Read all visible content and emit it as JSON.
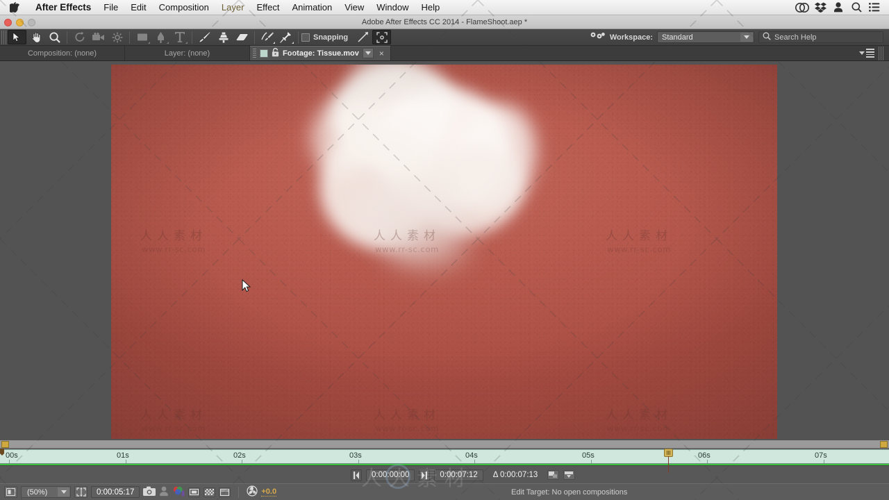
{
  "os_menu": {
    "apple_icon": "apple-logo",
    "items": [
      {
        "label": "After Effects",
        "bold": true,
        "highlight": false
      },
      {
        "label": "File",
        "bold": false,
        "highlight": false
      },
      {
        "label": "Edit",
        "bold": false,
        "highlight": false
      },
      {
        "label": "Composition",
        "bold": false,
        "highlight": false
      },
      {
        "label": "Layer",
        "bold": false,
        "highlight": true
      },
      {
        "label": "Effect",
        "bold": false,
        "highlight": false
      },
      {
        "label": "Animation",
        "bold": false,
        "highlight": false
      },
      {
        "label": "View",
        "bold": false,
        "highlight": false
      },
      {
        "label": "Window",
        "bold": false,
        "highlight": false
      },
      {
        "label": "Help",
        "bold": false,
        "highlight": false
      }
    ],
    "status_icons": [
      "creative-cloud-icon",
      "dropbox-icon",
      "user-icon",
      "spotlight-search-icon",
      "notification-center-icon"
    ]
  },
  "window": {
    "title": "Adobe After Effects CC 2014 - FlameShoot.aep *",
    "controls": [
      "close",
      "minimize",
      "zoom"
    ]
  },
  "toolbar": {
    "tools": [
      {
        "name": "selection-tool",
        "active": true,
        "dim": false
      },
      {
        "name": "hand-tool",
        "active": false,
        "dim": false
      },
      {
        "name": "zoom-tool",
        "active": false,
        "dim": false
      },
      {
        "name": "rotation-tool",
        "active": false,
        "dim": true
      },
      {
        "name": "camera-tool",
        "active": false,
        "dim": true
      },
      {
        "name": "pan-behind-tool",
        "active": false,
        "dim": true
      },
      {
        "name": "shape-tool",
        "active": false,
        "dim": true
      },
      {
        "name": "pen-tool",
        "active": false,
        "dim": true
      },
      {
        "name": "type-tool",
        "active": false,
        "dim": true
      },
      {
        "name": "brush-tool",
        "active": false,
        "dim": false
      },
      {
        "name": "clone-stamp-tool",
        "active": false,
        "dim": false
      },
      {
        "name": "eraser-tool",
        "active": false,
        "dim": false
      },
      {
        "name": "roto-brush-tool",
        "active": false,
        "dim": false
      },
      {
        "name": "puppet-pin-tool",
        "active": false,
        "dim": false
      }
    ],
    "snapping_label": "Snapping",
    "snapping_checked": false,
    "workspace_label": "Workspace:",
    "workspace_value": "Standard",
    "search_placeholder": "Search Help"
  },
  "panel_tabs": {
    "tabs": [
      {
        "label": "Composition: (none)",
        "active": false
      },
      {
        "label": "Layer: (none)",
        "active": false
      },
      {
        "label": "Footage: Tissue.mov",
        "active": true
      }
    ],
    "close_label": "×"
  },
  "viewer": {
    "watermark_cn": "人人素材",
    "watermark_url": "www.rr-sc.com",
    "background_color": "#b8584c",
    "subject": "white tissue"
  },
  "timeline": {
    "ticks": [
      "00s",
      "01s",
      "02s",
      "03s",
      "04s",
      "05s",
      "06s",
      "07s"
    ],
    "playhead_time_label": "0:00:05:17",
    "work_area_color": "#3fbf3f",
    "ruler_color": "#cfe7dd"
  },
  "transport": {
    "in_point": "0:00:00:00",
    "out_point": "0:00:07:12",
    "duration": "Δ 0:00:07:13",
    "in_icon": "in-point-icon",
    "out_icon": "out-point-icon",
    "ripple_icons": [
      "lift-work-area-icon",
      "extract-work-area-icon"
    ]
  },
  "statusbar": {
    "zoom_level": "(50%)",
    "current_time": "0:00:05:17",
    "exposure": "+0.0",
    "edit_target": "Edit Target: No open compositions",
    "icons": [
      "always-preview-this-view-icon",
      "region-of-interest-icon",
      "take-snapshot-icon",
      "show-snapshot-icon",
      "show-channel-icon",
      "resolution-icon",
      "transparency-grid-icon",
      "view-layout-icon",
      "exposure-icon"
    ]
  }
}
